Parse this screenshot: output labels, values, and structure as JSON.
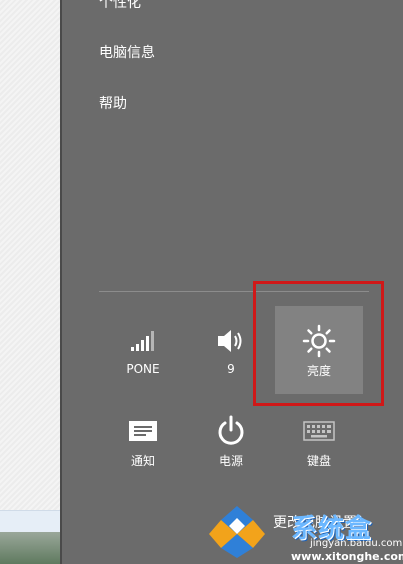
{
  "menu": {
    "items": [
      {
        "label": "个性化",
        "clipped": true
      },
      {
        "label": "电脑信息"
      },
      {
        "label": "帮助"
      }
    ]
  },
  "quick_settings": {
    "network": {
      "label": "PONE",
      "icon": "signal-bars-icon"
    },
    "volume": {
      "label": "9",
      "icon": "speaker-icon"
    },
    "brightness": {
      "label": "亮度",
      "icon": "sun-icon",
      "active": true
    },
    "notifications": {
      "label": "通知",
      "icon": "message-icon"
    },
    "power": {
      "label": "电源",
      "icon": "power-icon"
    },
    "keyboard": {
      "label": "键盘",
      "icon": "keyboard-icon"
    }
  },
  "more_settings": {
    "label": "更改电脑设置"
  },
  "watermark": {
    "brand": "系统盒",
    "url1": "jingyan.baidu.com",
    "url2": "www.xitonghe.com"
  },
  "colors": {
    "panel_bg": "#6b6b6b",
    "active_tile_bg": "#828282",
    "highlight_border": "#d01818"
  }
}
